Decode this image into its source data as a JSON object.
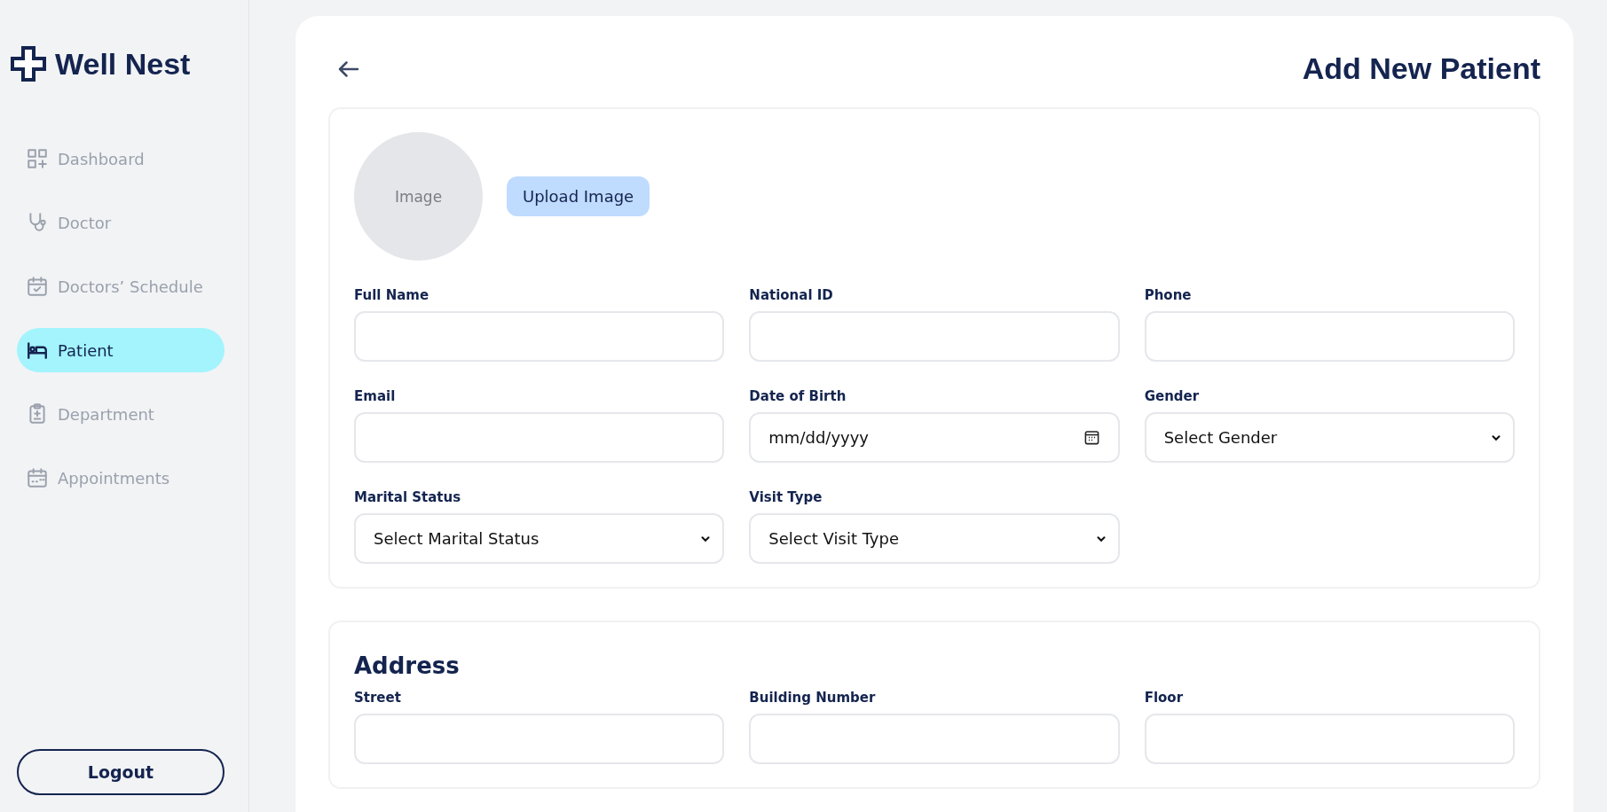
{
  "sidebar": {
    "brand": "Well Nest",
    "items": [
      {
        "label": "Dashboard",
        "selected": false
      },
      {
        "label": "Doctor",
        "selected": false
      },
      {
        "label": "Doctors’ Schedule",
        "selected": false
      },
      {
        "label": "Patient",
        "selected": true
      },
      {
        "label": "Department",
        "selected": false
      },
      {
        "label": "Appointments",
        "selected": false
      }
    ],
    "logout": "Logout"
  },
  "page": {
    "title": "Add New Patient"
  },
  "photo": {
    "placeholder_text": "Image",
    "upload_button": "Upload Image"
  },
  "fields": [
    {
      "label": "Full Name",
      "kind": "text"
    },
    {
      "label": "National ID",
      "kind": "text"
    },
    {
      "label": "Phone",
      "kind": "text"
    },
    {
      "label": "Email",
      "kind": "text"
    },
    {
      "label": "Date of Birth",
      "kind": "date",
      "placeholder": "mm/dd/yyyy"
    },
    {
      "label": "Gender",
      "kind": "select",
      "value": "Select Gender"
    },
    {
      "label": "Marital Status",
      "kind": "select",
      "value": "Select Marital Status"
    },
    {
      "label": "Visit Type",
      "kind": "select",
      "value": "Select Visit Type"
    }
  ],
  "address": {
    "title": "Address",
    "fields": [
      {
        "label": "Street"
      },
      {
        "label": "Building Number"
      },
      {
        "label": "Floor"
      }
    ]
  }
}
